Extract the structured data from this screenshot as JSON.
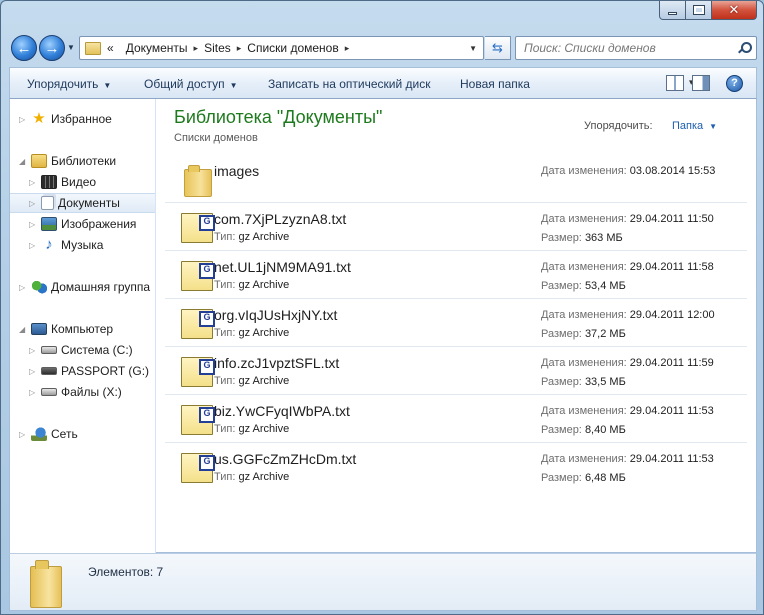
{
  "window": {
    "caption_buttons": [
      "minimize",
      "maximize",
      "close"
    ]
  },
  "address": {
    "overflow": "«",
    "crumbs": [
      "Документы",
      "Sites",
      "Списки доменов"
    ]
  },
  "search": {
    "placeholder": "Поиск: Списки доменов"
  },
  "toolbar": {
    "organize": "Упорядочить",
    "share": "Общий доступ",
    "burn": "Записать на оптический диск",
    "new_folder": "Новая папка"
  },
  "nav": {
    "favorites": "Избранное",
    "libraries": "Библиотеки",
    "video": "Видео",
    "documents": "Документы",
    "images": "Изображения",
    "music": "Музыка",
    "homegroup": "Домашняя группа",
    "computer": "Компьютер",
    "drive_c": "Система (C:)",
    "drive_g": "PASSPORT (G:)",
    "drive_x": "Файлы (X:)",
    "network": "Сеть"
  },
  "library": {
    "title": "Библиотека \"Документы\"",
    "subtitle": "Списки доменов",
    "arrange_label": "Упорядочить:",
    "arrange_value": "Папка"
  },
  "labels": {
    "modified": "Дата изменения:",
    "type": "Тип:",
    "size": "Размер:"
  },
  "files": [
    {
      "name": "images",
      "kind": "folder",
      "modified": "03.08.2014 15:53"
    },
    {
      "name": "com.7XjPLzyznA8.txt",
      "kind": "gz",
      "type": "gz Archive",
      "modified": "29.04.2011 11:50",
      "size": "363 МБ"
    },
    {
      "name": "net.UL1jNM9MA91.txt",
      "kind": "gz",
      "type": "gz Archive",
      "modified": "29.04.2011 11:58",
      "size": "53,4 МБ"
    },
    {
      "name": "org.vIqJUsHxjNY.txt",
      "kind": "gz",
      "type": "gz Archive",
      "modified": "29.04.2011 12:00",
      "size": "37,2 МБ"
    },
    {
      "name": "info.zcJ1vpztSFL.txt",
      "kind": "gz",
      "type": "gz Archive",
      "modified": "29.04.2011 11:59",
      "size": "33,5 МБ"
    },
    {
      "name": "biz.YwCFyqIWbPA.txt",
      "kind": "gz",
      "type": "gz Archive",
      "modified": "29.04.2011 11:53",
      "size": "8,40 МБ"
    },
    {
      "name": "us.GGFcZmZHcDm.txt",
      "kind": "gz",
      "type": "gz Archive",
      "modified": "29.04.2011 11:53",
      "size": "6,48 МБ"
    }
  ],
  "details": {
    "count": "Элементов: 7"
  }
}
